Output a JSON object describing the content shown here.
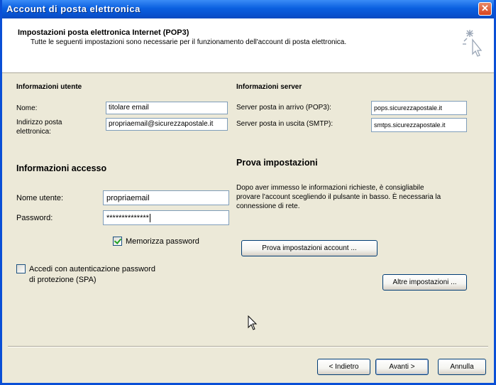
{
  "window": {
    "title": "Account di posta elettronica",
    "close_icon": "close-icon"
  },
  "header": {
    "title": "Impostazioni posta elettronica Internet (POP3)",
    "subtitle": "Tutte le seguenti impostazioni sono necessarie per il funzionamento dell'account di posta elettronica.",
    "icon": "wizard-sparkle-cursor-icon"
  },
  "user_info": {
    "section_title": "Informazioni utente",
    "name_label": "Nome:",
    "name_value": "titolare email",
    "email_label": "Indirizzo posta elettronica:",
    "email_value": "propriaemail@sicurezzapostale.it"
  },
  "server_info": {
    "section_title": "Informazioni server",
    "incoming_label": "Server posta in arrivo (POP3):",
    "incoming_value": "pops.sicurezzapostale.it",
    "outgoing_label": "Server posta in uscita (SMTP):",
    "outgoing_value": "smtps.sicurezzapostale.it"
  },
  "access_info": {
    "section_title": "Informazioni accesso",
    "username_label": "Nome utente:",
    "username_value": "propriaemail",
    "password_label": "Password:",
    "password_value": "**************",
    "remember_label": "Memorizza password",
    "remember_checked": true,
    "spa_label_line1": "Accedi con autenticazione password",
    "spa_label_line2": "di protezione (SPA)",
    "spa_checked": false
  },
  "test_settings": {
    "title": "Prova impostazioni",
    "description": "Dopo aver immesso le informazioni richieste, è consigliabile provare l'account scegliendo il pulsante in basso. È necessaria la connessione di rete.",
    "test_button": "Prova impostazioni account ...",
    "more_button": "Altre impostazioni ..."
  },
  "footer": {
    "back_button": "< Indietro",
    "next_button": "Avanti >",
    "cancel_button": "Annulla"
  },
  "colors": {
    "titlebar": "#0a5fe0",
    "dialog_bg": "#ece9d8",
    "field_border": "#7f9db9",
    "check_green": "#21a121"
  }
}
